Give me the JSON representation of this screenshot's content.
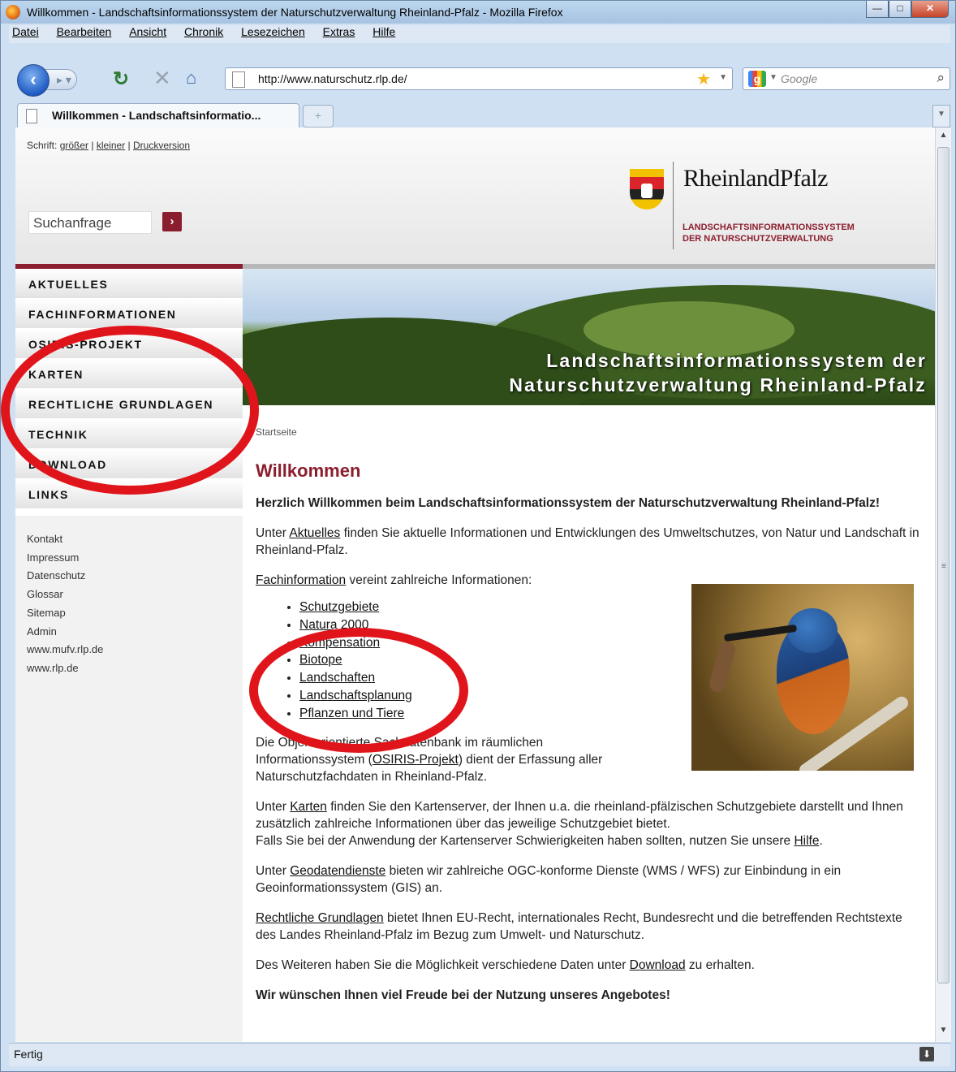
{
  "browser": {
    "window_title": "Willkommen - Landschaftsinformationssystem der Naturschutzverwaltung Rheinland-Pfalz - Mozilla Firefox",
    "menu": [
      "Datei",
      "Bearbeiten",
      "Ansicht",
      "Chronik",
      "Lesezeichen",
      "Extras",
      "Hilfe"
    ],
    "url": "http://www.naturschutz.rlp.de/",
    "search_placeholder": "Google",
    "tab_label": "Willkommen - Landschaftsinformatio...",
    "status": "Fertig"
  },
  "header": {
    "schrift_label": "Schrift:",
    "larger": "größer",
    "smaller": "kleiner",
    "print": "Druckversion",
    "search_value": "Suchanfrage",
    "search_go": "›",
    "logo_name": "RheinlandPfalz",
    "logo_sub_line1": "LANDSCHAFTSINFORMATIONSSYSTEM",
    "logo_sub_line2": "DER NATURSCHUTZVERWALTUNG"
  },
  "nav": {
    "items": [
      "AKTUELLES",
      "FACHINFORMATIONEN",
      "OSIRIS-PROJEKT",
      "KARTEN",
      "RECHTLICHE GRUNDLAGEN",
      "TECHNIK",
      "DOWNLOAD",
      "LINKS"
    ]
  },
  "sidelinks": [
    "Kontakt",
    "Impressum",
    "Datenschutz",
    "Glossar",
    "Sitemap",
    "Admin",
    "www.mufv.rlp.de",
    "www.rlp.de"
  ],
  "banner": {
    "line1": "Landschaftsinformationssystem der",
    "line2": "Naturschutzverwaltung Rheinland-Pfalz"
  },
  "breadcrumb": "Startseite",
  "content": {
    "title": "Willkommen",
    "intro": "Herzlich Willkommen beim Landschaftsinformationssystem der Naturschutzverwaltung Rheinland-Pfalz!",
    "p1_pre": "Unter ",
    "p1_link": "Aktuelles",
    "p1_post": " finden Sie aktuelle Informationen und Entwicklungen des Umweltschutzes, von Natur und Landschaft in Rheinland-Pfalz.",
    "p2_link": "Fachinformation",
    "p2_post": " vereint zahlreiche Informationen:",
    "list": [
      "Schutzgebiete",
      "Natura 2000",
      "Kompensation",
      "Biotope",
      "Landschaften",
      "Landschaftsplanung",
      "Pflanzen und Tiere"
    ],
    "p3_pre": "Die Objektorientierte Sachdatenbank im räumlichen Informationssystem (",
    "p3_link": "OSIRIS-Projekt",
    "p3_post": ") dient der Erfassung aller Naturschutzfachdaten in Rheinland-Pfalz.",
    "p4_pre": "Unter ",
    "p4_link": "Karten",
    "p4_post": " finden Sie den Kartenserver, der Ihnen u.a. die rheinland-pfälzischen Schutzgebiete darstellt und Ihnen zusätzlich zahlreiche Informationen über das jeweilige Schutzgebiet bietet.",
    "p4b_pre": "Falls Sie bei der Anwendung der Kartenserver Schwierigkeiten haben sollten, nutzen Sie unsere ",
    "p4b_link": "Hilfe",
    "p4b_post": ".",
    "p5_pre": "Unter ",
    "p5_link": "Geodatendienste",
    "p5_post": " bieten wir zahlreiche OGC-konforme Dienste (WMS / WFS) zur Einbindung in ein Geoinformationssystem (GIS) an.",
    "p6_link": "Rechtliche Grundlagen",
    "p6_post": " bietet Ihnen EU-Recht, internationales Recht, Bundesrecht und die betreffenden Rechtstexte des Landes Rheinland-Pfalz im Bezug zum Umwelt- und Naturschutz.",
    "p7_pre": "Des Weiteren haben Sie die Möglichkeit verschiedene Daten unter ",
    "p7_link": "Download",
    "p7_post": " zu erhalten.",
    "closing": "Wir wünschen Ihnen viel Freude bei der Nutzung unseres Angebotes!"
  },
  "colors": {
    "accent": "#8b1e2e",
    "annotation": "#e0151b"
  }
}
